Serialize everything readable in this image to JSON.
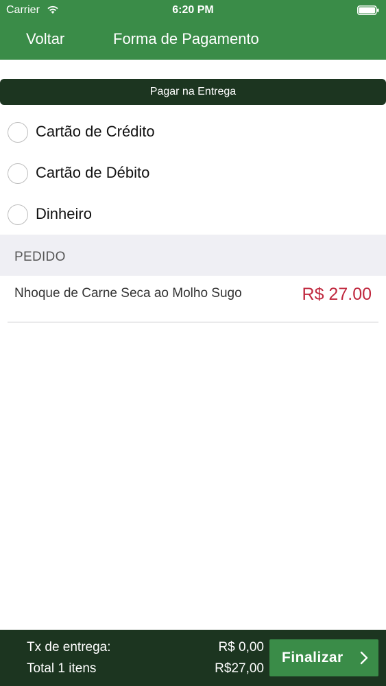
{
  "status_bar": {
    "carrier": "Carrier",
    "time": "6:20 PM"
  },
  "nav": {
    "back_label": "Voltar",
    "title": "Forma de Pagamento"
  },
  "section": {
    "title": "Pagar na Entrega"
  },
  "payment_options": [
    {
      "label": "Cartão de Crédito",
      "selected": false
    },
    {
      "label": "Cartão de Débito",
      "selected": false
    },
    {
      "label": "Dinheiro",
      "selected": false
    }
  ],
  "order": {
    "header": "PEDIDO",
    "items": [
      {
        "name": "Nhoque de Carne Seca ao Molho Sugo",
        "price": "R$ 27.00"
      }
    ]
  },
  "footer": {
    "fee_label": "Tx de entrega:",
    "fee_value": "R$ 0,00",
    "total_label": "Total  1 itens",
    "total_value": "R$27,00",
    "finalize_label": "Finalizar"
  },
  "colors": {
    "header_green": "#3a8c48",
    "dark_green": "#1c3520",
    "price_red": "#c0283e",
    "section_gray": "#efeff4"
  },
  "icons": [
    "wifi-icon",
    "battery-icon",
    "radio-icon",
    "chevron-right-icon"
  ]
}
